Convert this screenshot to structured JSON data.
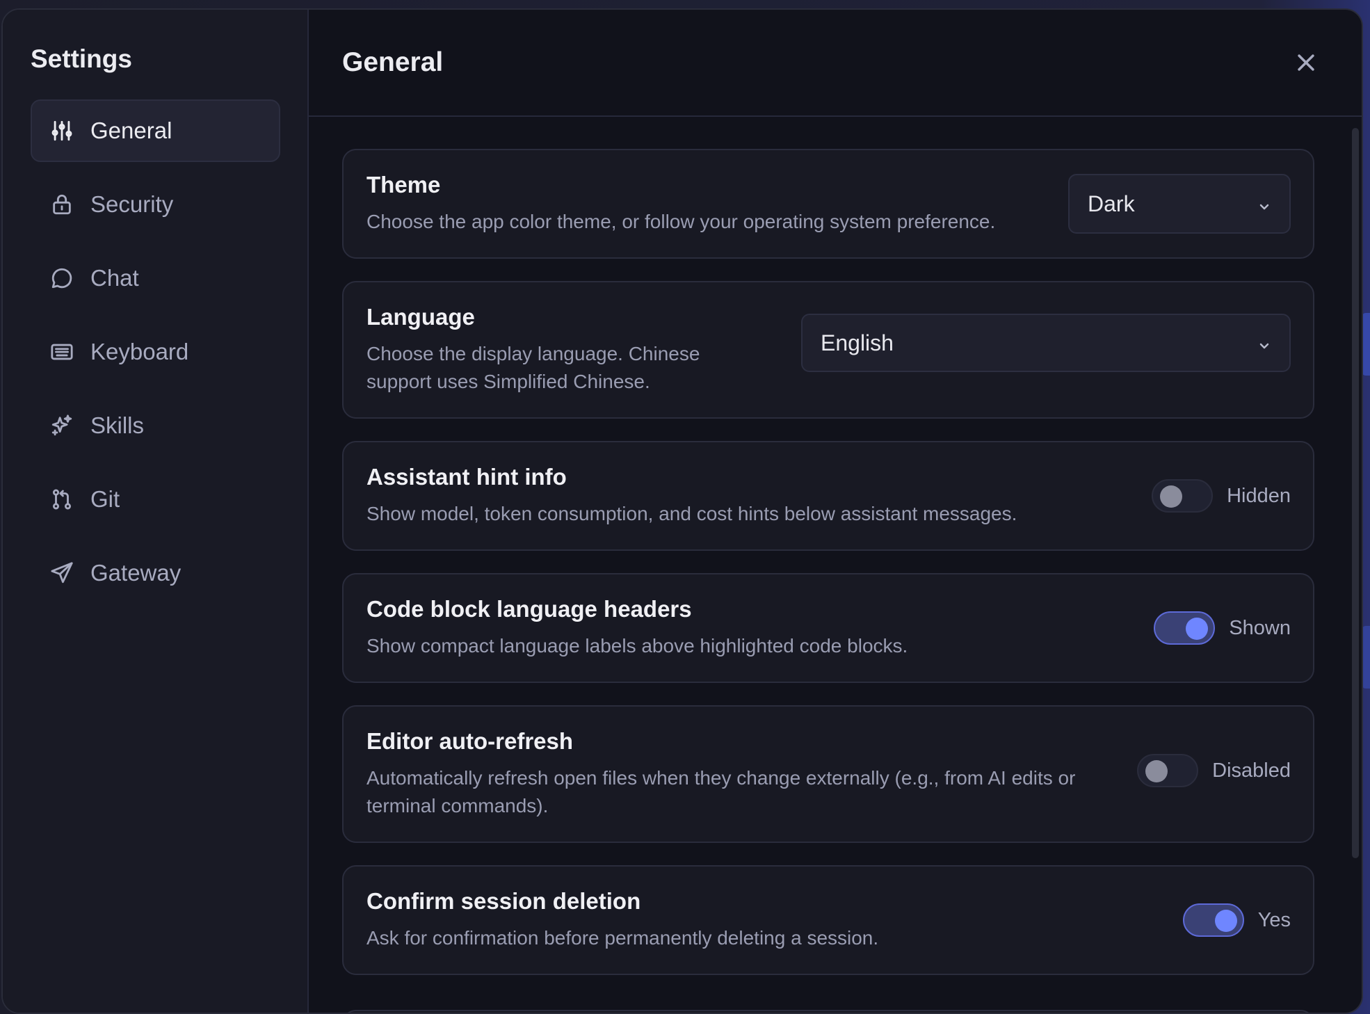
{
  "sidebar": {
    "title": "Settings",
    "items": [
      {
        "label": "General",
        "icon": "sliders-icon",
        "active": true
      },
      {
        "label": "Security",
        "icon": "lock-icon"
      },
      {
        "label": "Chat",
        "icon": "chat-bubble-icon"
      },
      {
        "label": "Keyboard",
        "icon": "keyboard-icon"
      },
      {
        "label": "Skills",
        "icon": "sparkles-icon"
      },
      {
        "label": "Git",
        "icon": "git-pull-request-icon"
      },
      {
        "label": "Gateway",
        "icon": "send-icon"
      }
    ]
  },
  "header": {
    "title": "General",
    "close_icon": "close-icon"
  },
  "settings": {
    "theme": {
      "title": "Theme",
      "description": "Choose the app color theme, or follow your operating system preference.",
      "value": "Dark"
    },
    "language": {
      "title": "Language",
      "description": "Choose the display language. Chinese support uses Simplified Chinese.",
      "value": "English"
    },
    "assistant_hint": {
      "title": "Assistant hint info",
      "description": "Show model, token consumption, and cost hints below assistant messages.",
      "state": "Hidden",
      "on": false
    },
    "code_headers": {
      "title": "Code block language headers",
      "description": "Show compact language labels above highlighted code blocks.",
      "state": "Shown",
      "on": true
    },
    "auto_refresh": {
      "title": "Editor auto-refresh",
      "description": "Automatically refresh open files when they change externally (e.g., from AI edits or terminal commands).",
      "state": "Disabled",
      "on": false
    },
    "confirm_delete": {
      "title": "Confirm session deletion",
      "description": "Ask for confirmation before permanently deleting a session.",
      "state": "Yes",
      "on": true
    }
  },
  "colors": {
    "accent": "#6f86ff",
    "background": "#11121b",
    "sidebar": "#191a25"
  }
}
